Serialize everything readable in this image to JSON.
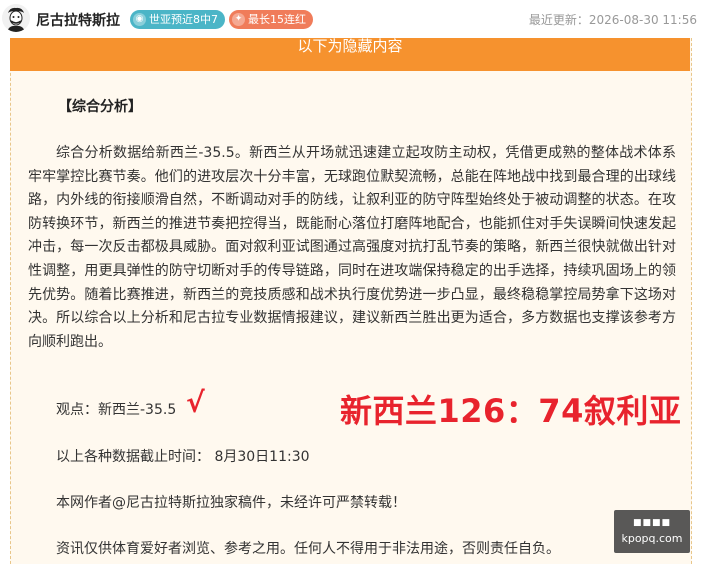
{
  "header": {
    "author_name": "尼古拉特斯拉",
    "badges": [
      {
        "icon": "globe-icon",
        "label": "世亚预近8中7",
        "color": "#4bb5c7"
      },
      {
        "icon": "flame-icon",
        "label": "最长15连红",
        "color": "#f07c5a"
      }
    ],
    "updated_label": "最近更新：2026-08-30 11:56"
  },
  "content": {
    "hidden_banner": "以下为隐藏内容",
    "section_title": "【综合分析】",
    "analysis": "综合分析数据给新西兰-35.5。新西兰从开场就迅速建立起攻防主动权，凭借更成熟的整体战术体系牢牢掌控比赛节奏。他们的进攻层次十分丰富，无球跑位默契流畅，总能在阵地战中找到最合理的出球线路，内外线的衔接顺滑自然，不断调动对手的防线，让叙利亚的防守阵型始终处于被动调整的状态。在攻防转换环节，新西兰的推进节奏把控得当，既能耐心落位打磨阵地配合，也能抓住对手失误瞬间快速发起冲击，每一次反击都极具威胁。面对叙利亚试图通过高强度对抗打乱节奏的策略，新西兰很快就做出针对性调整，用更具弹性的防守切断对手的传导链路，同时在进攻端保持稳定的出手选择，持续巩固场上的领先优势。随着比赛推进，新西兰的竞技质感和战术执行度优势进一步凸显，最终稳稳掌控局势拿下这场对决。所以综合以上分析和尼古拉专业数据情报建议，建议新西兰胜出更为适合，多方数据也支撑该参考方向顺利跑出。",
    "viewpoint": "观点：新西兰-35.5",
    "check_mark": "√",
    "final_score": "新西兰126：74叙利亚",
    "cutoff": "以上各种数据截止时间：  8月30日11:30",
    "copyright": "本网作者@尼古拉特斯拉独家稿件，未经许可严禁转载！",
    "disclaimer": "资讯仅供体育爱好者浏览、参考之用。任何人不得用于非法用途，否则责任自负。"
  },
  "watermark": {
    "line1": "■■■■",
    "line2": "kpopq.com"
  },
  "colors": {
    "banner": "#f6922e",
    "highlight_red": "#e8232d",
    "panel_bg": "#fff9ef"
  }
}
